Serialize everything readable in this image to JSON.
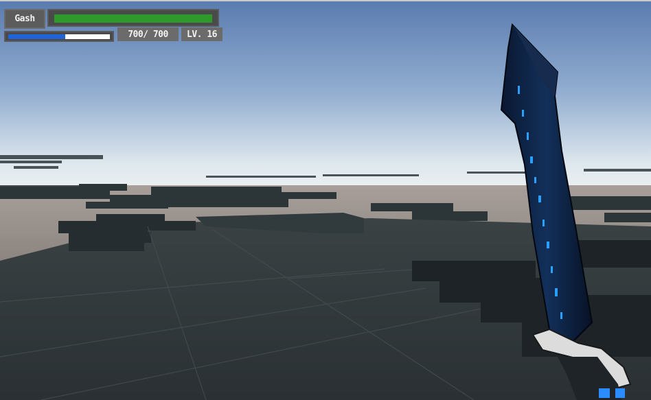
{
  "hud": {
    "player_name": "Gash",
    "health": {
      "current": 700,
      "max": 700,
      "fraction": 1.0
    },
    "mana": {
      "fraction": 0.56
    },
    "hp_readout": "700/ 700",
    "level_readout": "LV. 16"
  },
  "colors": {
    "health_fill": "#2e9a2b",
    "mana_fill": "#1f63d6",
    "sword_rune_glow": "#1f8fff",
    "sky_top": "#5f7fb3",
    "sky_horizon": "#e8edf0",
    "ground": "#2e3437"
  },
  "scene": {
    "held_item": "rune-sword",
    "environment": "voxel-terrain-under-sky"
  }
}
